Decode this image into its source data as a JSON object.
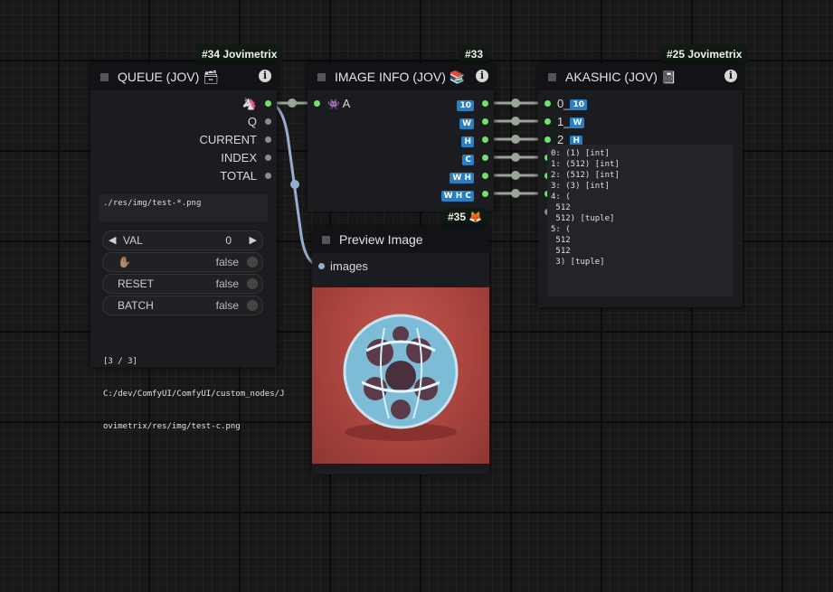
{
  "nodes": {
    "queue": {
      "badge": "#34 Jovimetrix",
      "title": "QUEUE (JOV) 🗃",
      "outputs": [
        "🦄",
        "Q",
        "CURRENT",
        "INDEX",
        "TOTAL"
      ],
      "path_text": "./res/img/test-*.png",
      "widgets": {
        "val_label": "VAL",
        "val_value": "0",
        "hold_label": "✋🏽",
        "hold_value": "false",
        "reset_label": "RESET",
        "reset_value": "false",
        "batch_label": "BATCH",
        "batch_value": "false"
      },
      "status_lines": [
        "[3 / 3]",
        "C:/dev/ComfyUI/ComfyUI/custom_nodes/J",
        "ovimetrix/res/img/test-c.png"
      ]
    },
    "image_info": {
      "badge": "#33",
      "title": "IMAGE INFO (JOV) 📚",
      "input": "A",
      "input_icon": "👾",
      "outputs": [
        "10",
        "W",
        "H",
        "C",
        "W H",
        "W H C"
      ]
    },
    "akashic": {
      "badge": "#25 Jovimetrix",
      "title": "AKASHIC (JOV) 📓",
      "inputs": [
        "0_",
        "1_",
        "2_"
      ],
      "input_tags": [
        "10",
        "W",
        "H"
      ],
      "output_text": "0: (1) [int]\n1: (512) [int]\n2: (512) [int]\n3: (3) [int]\n4: (\n 512\n 512) [tuple]\n5: (\n 512\n 512\n 3) [tuple]"
    },
    "preview": {
      "badge": "#35 🦊",
      "title": "Preview Image",
      "input": "images"
    }
  },
  "colors": {
    "link_green": "#6fe36f",
    "link_image": "#93aed0",
    "tag_blue": "#2a7fc2",
    "preview_bg": "#b04a44",
    "object": "#7dbcd6"
  }
}
